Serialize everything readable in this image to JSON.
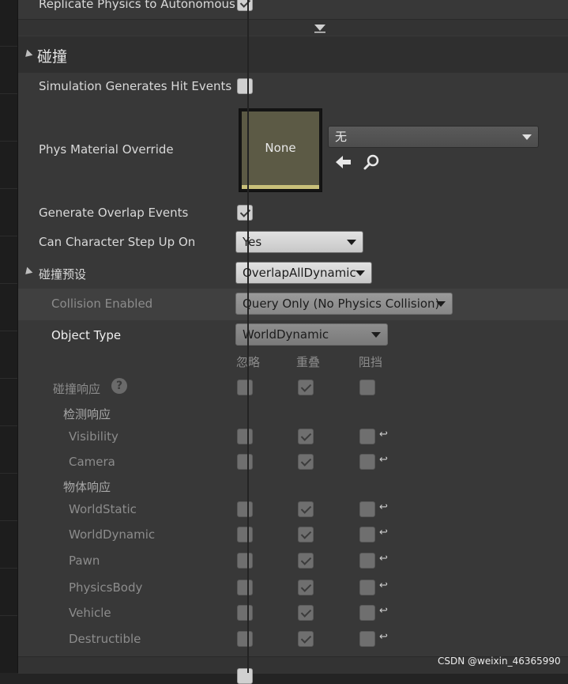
{
  "top_row": {
    "label": "Replicate Physics to Autonomous",
    "checked": true
  },
  "collision_section": {
    "title": "碰撞",
    "simulation_hit_events": {
      "label": "Simulation Generates Hit Events",
      "checked": false
    },
    "phys_material": {
      "label": "Phys Material Override",
      "thumbnail_text": "None",
      "dropdown_value": "无"
    },
    "generate_overlap": {
      "label": "Generate Overlap Events",
      "checked": true
    },
    "step_up": {
      "label": "Can Character Step Up On",
      "value": "Yes"
    },
    "presets": {
      "label": "碰撞预设",
      "value": "OverlapAllDynamic"
    },
    "collision_enabled": {
      "label": "Collision Enabled",
      "value": "Query Only (No Physics Collision)"
    },
    "object_type": {
      "label": "Object Type",
      "value": "WorldDynamic"
    },
    "columns": [
      "忽略",
      "重叠",
      "阻挡"
    ],
    "responses": {
      "label": "碰撞响应",
      "help": "?"
    },
    "trace_group": "检测响应",
    "trace_items": [
      "Visibility",
      "Camera"
    ],
    "object_group": "物体响应",
    "object_items": [
      "WorldStatic",
      "WorldDynamic",
      "Pawn",
      "PhysicsBody",
      "Vehicle",
      "Destructible"
    ]
  },
  "watermark": "CSDN @weixin_46365990",
  "colors": {
    "panel": "#383838",
    "header": "#2f2f2f",
    "subsection": "#404040",
    "swatch": "#5c5a45",
    "swatch_bar": "#c9c07a"
  }
}
